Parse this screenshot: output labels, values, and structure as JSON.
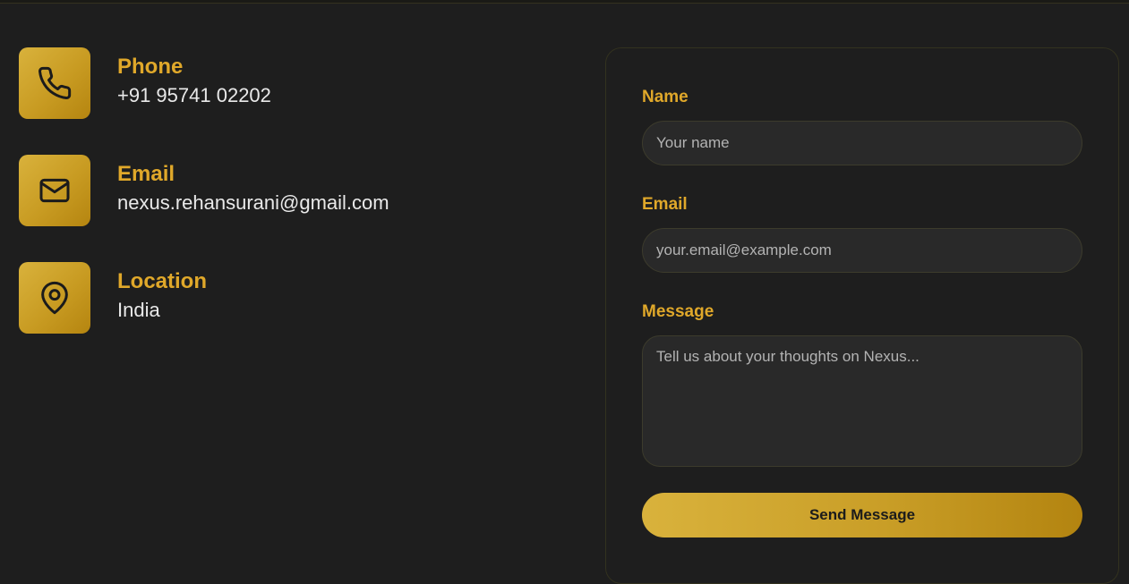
{
  "contact": {
    "items": [
      {
        "icon": "phone-icon",
        "label": "Phone",
        "value": "+91 95741 02202"
      },
      {
        "icon": "mail-icon",
        "label": "Email",
        "value": "nexus.rehansurani@gmail.com"
      },
      {
        "icon": "map-pin-icon",
        "label": "Location",
        "value": "India"
      }
    ]
  },
  "form": {
    "name_label": "Name",
    "name_placeholder": "Your name",
    "email_label": "Email",
    "email_placeholder": "your.email@example.com",
    "message_label": "Message",
    "message_placeholder": "Tell us about your thoughts on Nexus...",
    "submit_label": "Send Message"
  },
  "colors": {
    "accent": "#e0a82a",
    "background": "#1e1e1e",
    "input_background": "#292929",
    "gradient_start": "#d9b23c",
    "gradient_end": "#b58510"
  }
}
